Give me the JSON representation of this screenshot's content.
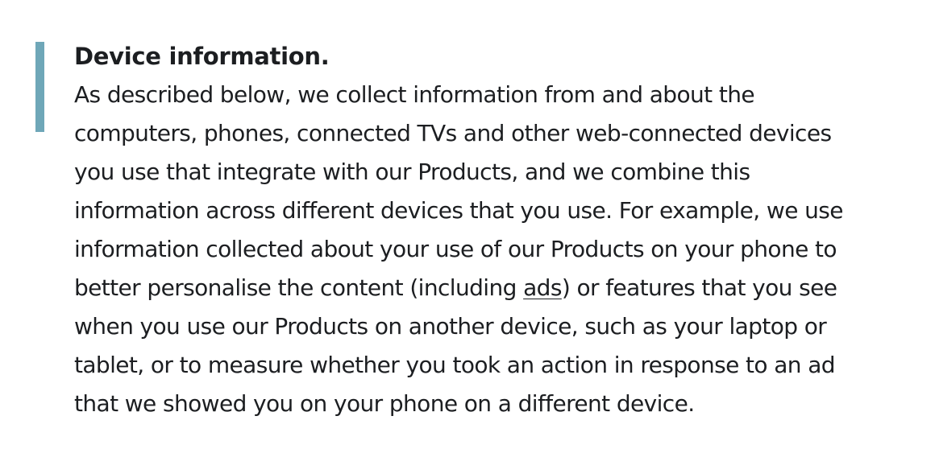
{
  "section": {
    "heading": "Device information.",
    "lines": [
      "As described below, we collect information from and about the",
      "computers, phones, connected TVs and other web-connected devices",
      "you use that integrate with our Products, and we combine this",
      "information across different devices that you use. For example, we use",
      "information collected about your use of our Products on your phone to"
    ],
    "line6_before": "better personalise the content (including ",
    "ads_link": "ads",
    "line6_after": ") or features that you see",
    "lines_end": [
      "when you use our Products on another device, such as your laptop or",
      "tablet, or to measure whether you took an action in response to an ad",
      "that we showed you on your phone on a different device."
    ]
  },
  "colors": {
    "accent_bar": "#6fa7b8",
    "text": "#1c1e21",
    "background": "#ffffff"
  }
}
